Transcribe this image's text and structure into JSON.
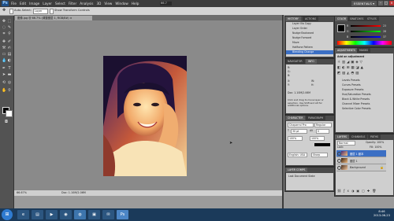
{
  "app": {
    "logo": "Ps",
    "workspace": "ESSENTIALS ▾",
    "zoom": "66.7"
  },
  "menu": [
    "File",
    "Edit",
    "Image",
    "Layer",
    "Select",
    "Filter",
    "Analysis",
    "3D",
    "View",
    "Window",
    "Help"
  ],
  "options": {
    "auto_select": "Auto-Select:",
    "auto_select_value": "Layer",
    "show_transform": "Show Transform Controls"
  },
  "document": {
    "tab_title": "图像.jpg @ 66.7% (调整图层 1, RGB/8#) ×",
    "status_zoom": "66.67%",
    "status_doc": "Doc: 1.10M/2.06M"
  },
  "history": {
    "tabs": [
      "HISTORY",
      "ACTIONS"
    ],
    "items": [
      "Layer Via Copy",
      "Layer Order",
      "Nudge Backward",
      "Nudge Forward",
      "Move",
      "Halftone Pattern",
      "Blending Change"
    ]
  },
  "color": {
    "tabs": [
      "COLOR",
      "SWATCHES",
      "STYLES"
    ],
    "channels": [
      "R",
      "G",
      "B"
    ],
    "values": [
      "23",
      "28",
      "37"
    ]
  },
  "adjustments": {
    "tabs": [
      "ADJUSTMENTS",
      "MASKS"
    ],
    "heading": "Add an adjustment",
    "presets": [
      "Levels Presets",
      "Curves Presets",
      "Exposure Presets",
      "Hue/Saturation Presets",
      "Black & White Presets",
      "Channel Mixer Presets",
      "Selective Color Presets"
    ]
  },
  "navigator": {
    "tabs": [
      "NAVIGATOR",
      "INFO"
    ],
    "labels": [
      "R:",
      "G:",
      "B:",
      "X:",
      "Y:",
      "W:",
      "H:"
    ],
    "doc": "Doc: 1.10M/2.06M",
    "hint": "Click and drag to move layer or selection. Use Shift and Alt for additional options."
  },
  "character": {
    "tabs": [
      "CHARACTER",
      "PARAGRAPH"
    ],
    "font": "Chaparral Pro",
    "style": "Regular",
    "size": "30 pt",
    "tracking": "0",
    "scale_v": "100%",
    "scale_h": "100%",
    "lang": "English: USA",
    "aa": "Sharp"
  },
  "layer_comps": {
    "tabs": [
      "LAYER COMPS"
    ],
    "last_state": "Last Document State"
  },
  "layers": {
    "tabs": [
      "LAYERS",
      "CHANNELS",
      "PATHS"
    ],
    "blend": "Normal",
    "opacity": "Opacity: 100%",
    "lock": "Lock:",
    "fill": "Fill: 100%",
    "rows": [
      "图层 1 副本",
      "图层 1",
      "Background"
    ]
  },
  "taskbar": {
    "time": "8:46",
    "date": "2013-06-23"
  },
  "colors": {
    "selected_row": "#3b6fc4",
    "panel_bg": "#4a4a4a",
    "canvas_bg": "#8a8a8a"
  }
}
